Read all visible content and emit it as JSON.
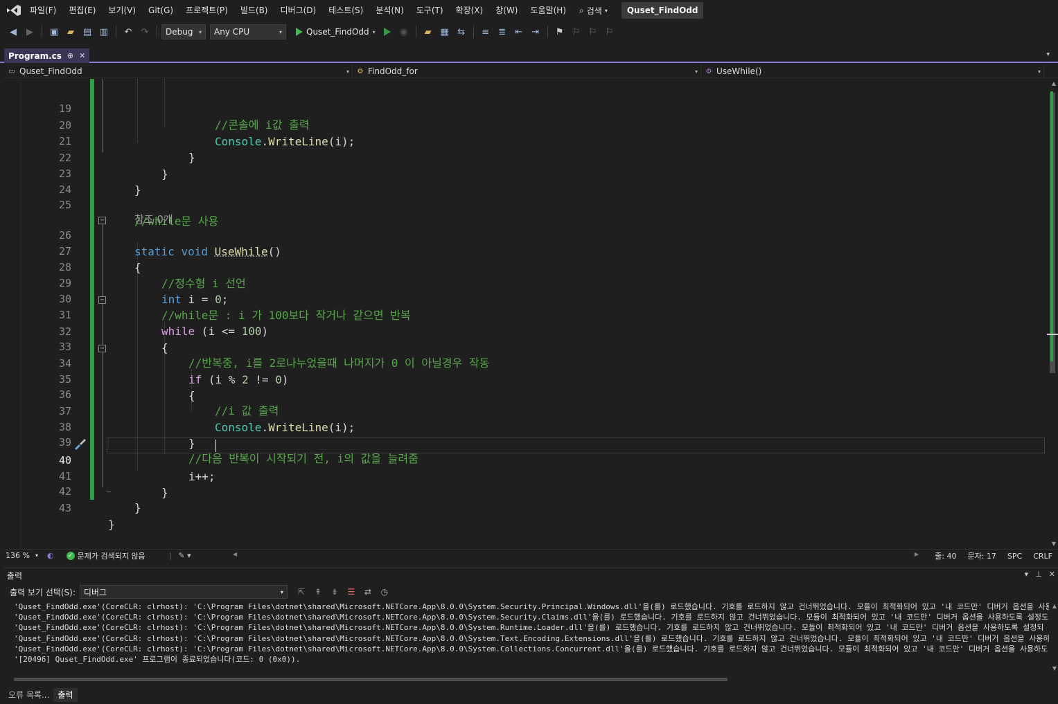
{
  "menu": {
    "items": [
      "파일(F)",
      "편집(E)",
      "보기(V)",
      "Git(G)",
      "프로젝트(P)",
      "빌드(B)",
      "디버그(D)",
      "테스트(S)",
      "분석(N)",
      "도구(T)",
      "확장(X)",
      "창(W)",
      "도움말(H)"
    ],
    "search_label": "검색",
    "solution_name": "Quset_FindOdd"
  },
  "toolbar": {
    "configuration": "Debug",
    "platform": "Any CPU",
    "run_target": "Quset_FindOdd"
  },
  "document_tab": {
    "name": "Program.cs",
    "pin": "⊕",
    "close": "✕"
  },
  "navbar": {
    "project": "Quset_FindOdd",
    "class": "FindOdd_for",
    "member": "UseWhile()"
  },
  "code_lines": [
    {
      "num": "19",
      "text": "//콘솔에 i값 출력"
    },
    {
      "num": "20",
      "text": "Console.WriteLine(i);"
    },
    {
      "num": "21",
      "text": "}"
    },
    {
      "num": "22",
      "text": "}"
    },
    {
      "num": "23",
      "text": "}"
    },
    {
      "num": "24",
      "text": ""
    },
    {
      "num": "25",
      "text": "//while문 사용"
    },
    {
      "num": "",
      "text": "참조 0개"
    },
    {
      "num": "26",
      "text": "static void UseWhile()"
    },
    {
      "num": "27",
      "text": "{"
    },
    {
      "num": "28",
      "text": "//정수형 i 선언"
    },
    {
      "num": "29",
      "text": "int i = 0;"
    },
    {
      "num": "30",
      "text": "//while문 : i 가 100보다 작거나 같으면 반복"
    },
    {
      "num": "31",
      "text": "while (i <= 100)"
    },
    {
      "num": "32",
      "text": "{"
    },
    {
      "num": "33",
      "text": "//반복중, i를 2로나누었을때 나머지가 0 이 아닐경우 작동"
    },
    {
      "num": "34",
      "text": "if (i % 2 != 0)"
    },
    {
      "num": "35",
      "text": "{"
    },
    {
      "num": "36",
      "text": "//i 값 출력"
    },
    {
      "num": "37",
      "text": "Console.WriteLine(i);"
    },
    {
      "num": "38",
      "text": "}"
    },
    {
      "num": "39",
      "text": "//다음 반복이 시작되기 전, i의 값을 늘려줌"
    },
    {
      "num": "40",
      "text": "i++;"
    },
    {
      "num": "41",
      "text": "}"
    },
    {
      "num": "42",
      "text": "}"
    },
    {
      "num": "43",
      "text": "}"
    }
  ],
  "editor_status": {
    "zoom": "136 %",
    "issues": "문제가 검색되지 않음",
    "line": "줄: 40",
    "column": "문자: 17",
    "whitespace": "SPC",
    "line_ending": "CRLF"
  },
  "output": {
    "title": "출력",
    "source_label": "출력 보기 선택(S):",
    "source_value": "디버그",
    "lines": [
      "'Quset_FindOdd.exe'(CoreCLR: clrhost): 'C:\\Program Files\\dotnet\\shared\\Microsoft.NETCore.App\\8.0.0\\System.Security.Principal.Windows.dll'을(를) 로드했습니다. 기호를 로드하지 않고 건너뛰었습니다. 모듈이 최적화되어 있고 '내 코드만' 디버거 옵션을 사용하도",
      "'Quset_FindOdd.exe'(CoreCLR: clrhost): 'C:\\Program Files\\dotnet\\shared\\Microsoft.NETCore.App\\8.0.0\\System.Security.Claims.dll'을(를) 로드했습니다. 기호를 로드하지 않고 건너뛰었습니다. 모듈이 최적화되어 있고 '내 코드만' 디버거 옵션을 사용하도록 설정도",
      "'Quset_FindOdd.exe'(CoreCLR: clrhost): 'C:\\Program Files\\dotnet\\shared\\Microsoft.NETCore.App\\8.0.0\\System.Runtime.Loader.dll'을(를) 로드했습니다. 기호를 로드하지 않고 건너뛰었습니다. 모듈이 최적화되어 있고 '내 코드만' 디버거 옵션을 사용하도록 설정되",
      "'Quset_FindOdd.exe'(CoreCLR: clrhost): 'C:\\Program Files\\dotnet\\shared\\Microsoft.NETCore.App\\8.0.0\\System.Text.Encoding.Extensions.dll'을(를) 로드했습니다. 기호를 로드하지 않고 건너뛰었습니다. 모듈이 최적화되어 있고 '내 코드만' 디버거 옵션을 사용하도",
      "'Quset_FindOdd.exe'(CoreCLR: clrhost): 'C:\\Program Files\\dotnet\\shared\\Microsoft.NETCore.App\\8.0.0\\System.Collections.Concurrent.dll'을(를) 로드했습니다. 기호를 로드하지 않고 건너뛰었습니다. 모듈이 최적화되어 있고 '내 코드만' 디버거 옵션을 사용하도",
      "'[20496] Quset_FindOdd.exe' 프로그램이 종료되었습니다(코드: 0 (0x0))."
    ]
  },
  "bottom_tabs": [
    "오류 목록...",
    "출력"
  ],
  "colors": {
    "comment": "#57a64a",
    "keyword": "#569cd6",
    "control": "#d8a0df",
    "type": "#4ec9b0",
    "method": "#dcdcaa",
    "change_bar": "#2ea043",
    "tab_accent": "#8f7bd6"
  }
}
